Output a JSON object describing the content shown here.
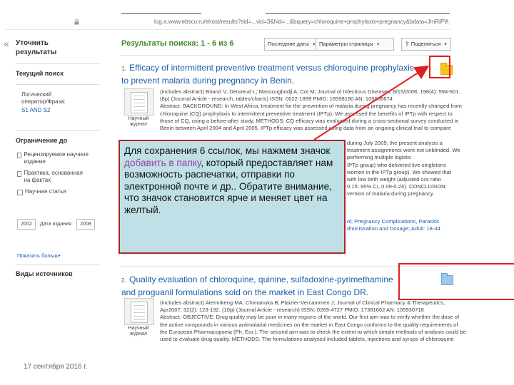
{
  "browser": {
    "url": "log.a.www.ebsco.ru/ehost/results?sid=...vid=3&hid=...&bquery=chloroquine+prophylaxis+pregnancy&bdata=JmRiPWE5aCZ0eXBlPTA%3d"
  },
  "sidebar": {
    "collapse_glyph": "«",
    "refine_title": "Уточнить результаты",
    "current_search_title": "Текущий поиск",
    "boolean_label": "Логический оператор/Фраза:",
    "boolean_value": "S1 AND S2",
    "limit_title": "Ограничение до",
    "limits": [
      {
        "label": "Рецензируемое научное издание"
      },
      {
        "label": "Практика, основанная на фактах"
      },
      {
        "label": "Научная статья"
      }
    ],
    "year_from": "2002",
    "date_label": "Дата издания",
    "year_to": "2008",
    "show_more": "Показать больше",
    "source_types_title": "Виды источников"
  },
  "results": {
    "title": "Результаты поиска: 1 - 6 из 6",
    "sort_label": "Последние даты",
    "page_options_label": "Параметры страницы",
    "share_label": "Поделиться"
  },
  "result1": {
    "num": "1.",
    "title": "Efficacy of intermittent preventive treatment versus chloroquine prophylaxis to prevent malaria during pregnancy in Benin.",
    "meta1": "(includes abstract) Briand V; Denoeud L; Massougbodji A; Cot M; Journal of Infectious Diseases, 8/15/2008; 198(4): 594-601.",
    "meta2": "(8p) (Journal Article - research, tables/charts) ISSN: 0022-1899 PMID: 18598190 AN: 105666674",
    "meta3": "Abstract: BACKGROUND: In West Africa, treatment for the prevention of malaria during pregnancy has recently changed from",
    "meta4": "chloroquine (CQ) prophylaxis to intermittent preventive treatment (IPTp). We assessed the benefits of IPTp with respect to",
    "meta5": "those of CQ, using a before-after study. METHODS: CQ efficacy was evaluated during a cross-sectional survey conducted in",
    "meta6": "Benin between April 2004 and April 2005. IPTp efficacy was assessed using data from an ongoing clinical trial to compare",
    "meta7": "during July 2005; the present analysis a",
    "meta8": "treatment assignments were not unblinded. We",
    "meta9": "performing multiple logistic",
    "meta10": "IPTp group) who delivered live singletons",
    "meta11": "women in the IPTp group). We showed that",
    "meta12": "with low birth weight (adjusted ccs ratio",
    "meta13": "0.15; 95% CI, 0.09-0.24). CONCLUSION:",
    "meta14": "vention of malaria during pregnancy.",
    "subjects1": "ol; Pregnancy Complications, Parasitic",
    "subjects2": "dministration and Dosage; Adult: 18-44",
    "thumb_label": "Научный журнал"
  },
  "result2": {
    "num": "2.",
    "title": "Quality evaluation of chloroquine, quinine, sulfadoxine-pyrimethamine and proguanil formulations sold on the market in East Congo DR.",
    "meta1": "(includes abstract) Atemnkeng MA; Chimanuka B; Plaizier-Vercammen J; Journal of Clinical Pharmacy & Therapeutics,",
    "meta2": "Apr2007; 32(2): 123-132. (10p) (Journal Article - research) ISSN: 0269-4727 PMID: 17381662 AN: 105930718",
    "meta3": "Abstract: OBJECTIVE: Drug quality may be poor in many regions of the world. Our first aim was to verify whether the dose of",
    "meta4": "the active compounds in various antimalarial medicines on the market in East Congo conforms to the quality requirements of",
    "meta5": "the European Pharmacopoeia (Ph. Eur.). The second aim was to check the extent to which simple methods of analysis could be",
    "meta6": "used to evaluate drug quality. METHODS: The formulations analysed included tablets, injections and syrups of chloroquine",
    "thumb_label": "Научный журнал"
  },
  "callout": {
    "text_before": "Для сохранения 6 ссылок, мы нажмем значок ",
    "text_accent": "добавить в папку",
    "text_after": ", который предоставляет нам возможность распечатки, отправки по электронной почте и др.. Обратите внимание, что значок становится ярче и меняет цвет на желтый."
  },
  "footer": {
    "date": "17 сентября 2016 г."
  },
  "colors": {
    "link": "#1a5ea8",
    "results_title": "#3f8a2a",
    "callout_bg": "#bfe0e6",
    "callout_border": "#b3232a",
    "annotation_red": "#e02020",
    "folder_active": "#f5c518",
    "folder_inactive": "#9ec9ec"
  }
}
